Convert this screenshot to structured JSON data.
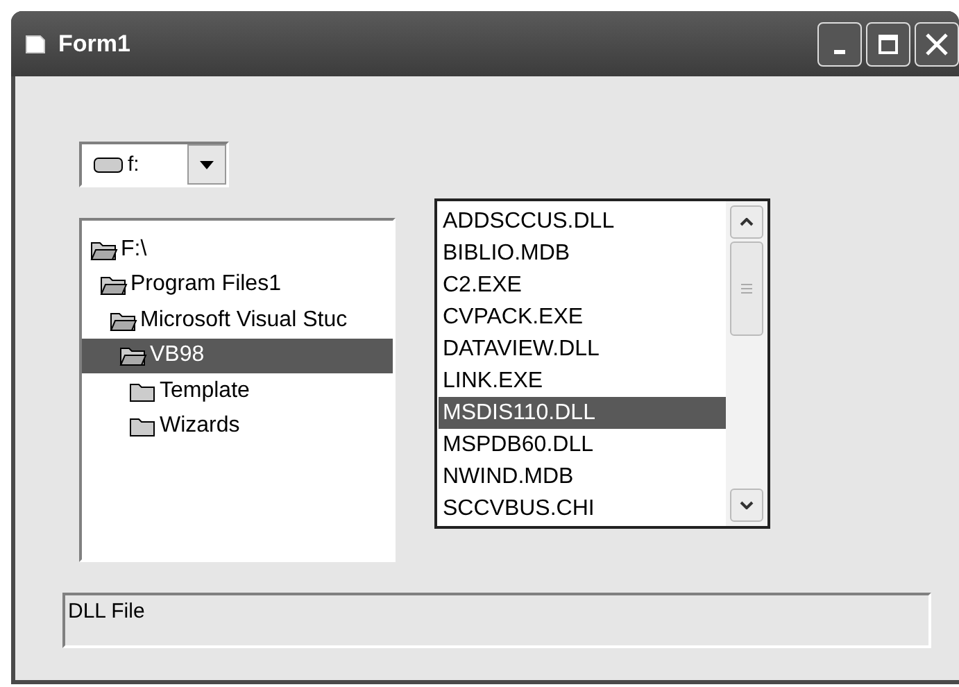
{
  "window": {
    "title": "Form1"
  },
  "drive": {
    "value": "f:"
  },
  "dir_tree": [
    {
      "label": "F:\\",
      "expanded": true,
      "selected": false,
      "children": [
        {
          "label": "Program Files1",
          "expanded": true,
          "selected": false,
          "children": [
            {
              "label": "Microsoft Visual Stuc",
              "expanded": true,
              "selected": false,
              "children": [
                {
                  "label": "VB98",
                  "expanded": true,
                  "selected": true,
                  "children": [
                    {
                      "label": "Template",
                      "expanded": false,
                      "selected": false
                    },
                    {
                      "label": "Wizards",
                      "expanded": false,
                      "selected": false
                    }
                  ]
                }
              ]
            }
          ]
        }
      ]
    }
  ],
  "files": [
    {
      "name": "ADDSCCUS.DLL",
      "selected": false
    },
    {
      "name": "BIBLIO.MDB",
      "selected": false
    },
    {
      "name": "C2.EXE",
      "selected": false
    },
    {
      "name": "CVPACK.EXE",
      "selected": false
    },
    {
      "name": "DATAVIEW.DLL",
      "selected": false
    },
    {
      "name": "LINK.EXE",
      "selected": false
    },
    {
      "name": "MSDIS110.DLL",
      "selected": true
    },
    {
      "name": "MSPDB60.DLL",
      "selected": false
    },
    {
      "name": "NWIND.MDB",
      "selected": false
    },
    {
      "name": "SCCVBUS.CHI",
      "selected": false
    }
  ],
  "status": "DLL File"
}
